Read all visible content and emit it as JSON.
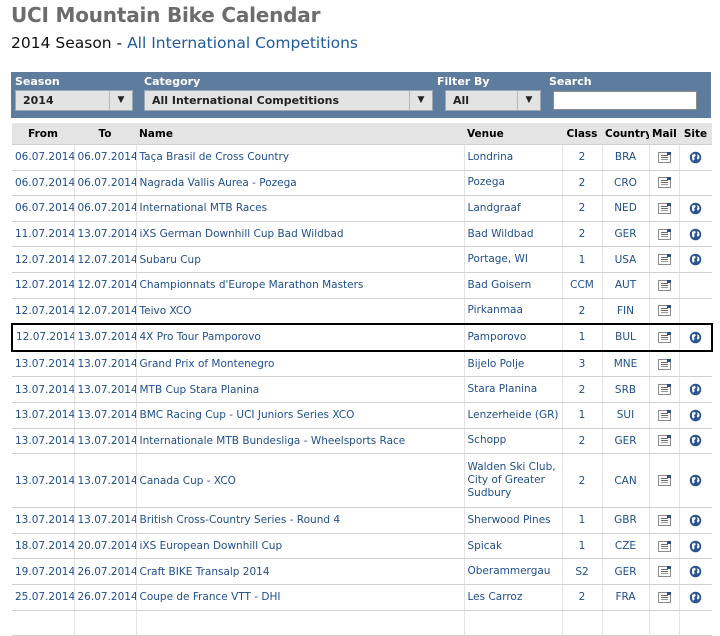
{
  "header": {
    "title": "UCI Mountain Bike Calendar",
    "season_text": "2014 Season - ",
    "season_link": "All International Competitions"
  },
  "filters": {
    "season": {
      "label": "Season",
      "value": "2014"
    },
    "category": {
      "label": "Category",
      "value": "All International Competitions"
    },
    "filter_by": {
      "label": "Filter By",
      "value": "All"
    },
    "search": {
      "label": "Search",
      "value": ""
    }
  },
  "table": {
    "columns": [
      "From",
      "To",
      "Name",
      "Venue",
      "Class",
      "Country",
      "Mail",
      "Site"
    ],
    "rows": [
      {
        "from": "06.07.2014",
        "to": "06.07.2014",
        "name": "Taça Brasil de Cross Country",
        "venue": "Londrina",
        "class": "2",
        "country": "BRA",
        "mail": true,
        "site": true
      },
      {
        "from": "06.07.2014",
        "to": "06.07.2014",
        "name": "Nagrada Vallis Aurea - Pozega",
        "venue": "Pozega",
        "class": "2",
        "country": "CRO",
        "mail": true,
        "site": false
      },
      {
        "from": "06.07.2014",
        "to": "06.07.2014",
        "name": "International MTB Races",
        "venue": "Landgraaf",
        "class": "2",
        "country": "NED",
        "mail": true,
        "site": true
      },
      {
        "from": "11.07.2014",
        "to": "13.07.2014",
        "name": "iXS German Downhill Cup Bad Wildbad",
        "venue": "Bad Wildbad",
        "class": "2",
        "country": "GER",
        "mail": true,
        "site": true
      },
      {
        "from": "12.07.2014",
        "to": "12.07.2014",
        "name": "Subaru Cup",
        "venue": "Portage, WI",
        "class": "1",
        "country": "USA",
        "mail": true,
        "site": true
      },
      {
        "from": "12.07.2014",
        "to": "12.07.2014",
        "name": "Championnats d'Europe Marathon Masters",
        "venue": "Bad Goisern",
        "class": "CCM",
        "country": "AUT",
        "mail": true,
        "site": false
      },
      {
        "from": "12.07.2014",
        "to": "12.07.2014",
        "name": "Teivo XCO",
        "venue": "Pirkanmaa",
        "class": "2",
        "country": "FIN",
        "mail": true,
        "site": false
      },
      {
        "from": "12.07.2014",
        "to": "13.07.2014",
        "name": "4X Pro Tour Pamporovo",
        "venue": "Pamporovo",
        "class": "1",
        "country": "BUL",
        "mail": true,
        "site": true,
        "selected": true
      },
      {
        "from": "13.07.2014",
        "to": "13.07.2014",
        "name": "Grand Prix of Montenegro",
        "venue": "Bijelo Polje",
        "class": "3",
        "country": "MNE",
        "mail": true,
        "site": false
      },
      {
        "from": "13.07.2014",
        "to": "13.07.2014",
        "name": "MTB Cup Stara Planina",
        "venue": "Stara Planina",
        "class": "2",
        "country": "SRB",
        "mail": true,
        "site": true
      },
      {
        "from": "13.07.2014",
        "to": "13.07.2014",
        "name": "BMC Racing Cup - UCI Juniors Series XCO",
        "venue": "Lenzerheide (GR)",
        "class": "1",
        "country": "SUI",
        "mail": true,
        "site": true
      },
      {
        "from": "13.07.2014",
        "to": "13.07.2014",
        "name": "Internationale MTB Bundesliga - Wheelsports Race",
        "venue": "Schopp",
        "class": "2",
        "country": "GER",
        "mail": true,
        "site": true
      },
      {
        "from": "13.07.2014",
        "to": "13.07.2014",
        "name": "Canada Cup - XCO",
        "venue": "Walden Ski Club, City of Greater Sudbury",
        "class": "2",
        "country": "CAN",
        "mail": true,
        "site": true,
        "tall": true
      },
      {
        "from": "13.07.2014",
        "to": "13.07.2014",
        "name": "British Cross-Country Series - Round 4",
        "venue": "Sherwood Pines",
        "class": "1",
        "country": "GBR",
        "mail": true,
        "site": true
      },
      {
        "from": "18.07.2014",
        "to": "20.07.2014",
        "name": "iXS European Downhill Cup",
        "venue": "Spicak",
        "class": "1",
        "country": "CZE",
        "mail": true,
        "site": true
      },
      {
        "from": "19.07.2014",
        "to": "26.07.2014",
        "name": "Craft BIKE Transalp 2014",
        "venue": "Oberammergau",
        "class": "S2",
        "country": "GER",
        "mail": true,
        "site": true
      },
      {
        "from": "25.07.2014",
        "to": "26.07.2014",
        "name": "Coupe de France VTT - DHI",
        "venue": "Les Carroz",
        "class": "2",
        "country": "FRA",
        "mail": true,
        "site": true
      },
      {
        "from": "",
        "to": "",
        "name": "",
        "venue": "",
        "class": "",
        "country": "",
        "mail": false,
        "site": false
      }
    ]
  },
  "colors": {
    "filter_bar": "#5e7d9e",
    "link": "#1f4f8a",
    "header_bg": "#e4e4e4",
    "title": "#6c6c6c"
  },
  "icons": {
    "mail": "mail-icon",
    "site": "globe-icon"
  }
}
